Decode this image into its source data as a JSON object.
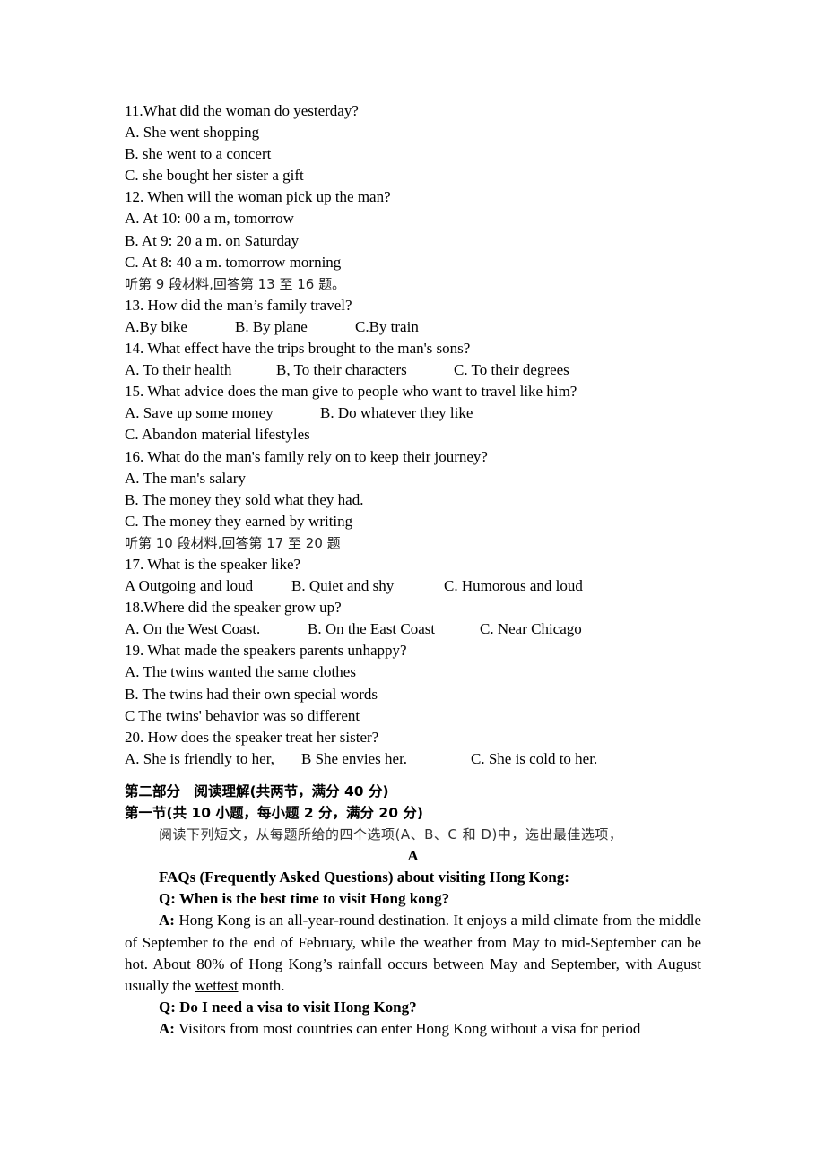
{
  "questions": [
    {
      "q": "11.What did the woman do yesterday?",
      "options": [
        "A. She went shopping",
        "B. she went to a concert",
        "C. she bought her sister a gift"
      ],
      "layout": "stacked"
    },
    {
      "q": "12. When will the woman pick up the man?",
      "options": [
        "A. At 10: 00 a m, tomorrow",
        "B. At 9: 20 a m. on Saturday",
        "C. At 8: 40 a m. tomorrow morning"
      ],
      "layout": "stacked"
    }
  ],
  "section9": "听第 9 段材料,回答第 13 至 16 题。",
  "q13": {
    "q": "13. How did the man’s family travel?",
    "options": [
      "A.By bike",
      "B. By plane",
      "C.By train"
    ]
  },
  "q14": {
    "q": "14. What effect have the trips brought to the man's sons?",
    "options": [
      "A. To their health",
      "B, To their characters",
      "C. To their degrees"
    ]
  },
  "q15": {
    "q": "15. What advice does the man give to people who want to travel like him?",
    "options": [
      "A. Save up some money",
      "B. Do whatever they like",
      "C. Abandon material lifestyles"
    ]
  },
  "q16": {
    "q": "16. What do the man's family rely on to keep their journey?",
    "options": [
      "A. The man's salary",
      "B. The money they sold what they had.",
      "C. The money they earned by writing"
    ]
  },
  "section10": "听第 10 段材料,回答第 17 至 20 题",
  "q17": {
    "q": "17. What is the speaker like?",
    "options": [
      "A Outgoing and loud",
      "B. Quiet and shy",
      "C. Humorous and loud"
    ]
  },
  "q18": {
    "q": "18.Where did the speaker grow up?",
    "options": [
      "A. On the West Coast.",
      "B. On the East Coast",
      "C. Near Chicago"
    ]
  },
  "q19": {
    "q": "19. What made the speakers parents unhappy?",
    "options": [
      "A. The twins wanted the same clothes",
      "B. The twins had their own special words",
      "C The twins' behavior was so different"
    ]
  },
  "q20": {
    "q": "20. How does the speaker treat her sister?",
    "options": [
      "A. She is friendly to her,",
      "B She envies her.",
      "C. She is cold to her."
    ]
  },
  "part2": {
    "title": "第二部分　阅读理解(共两节，满分 40 分)",
    "section1": "第一节(共 10 小题，每小题 2 分，满分 20 分)",
    "instruction": "阅读下列短文，从每题所给的四个选项(A、B、C 和 D)中，选出最佳选项，",
    "passage_label": "A",
    "faq_title": "FAQs (Frequently Asked Questions) about visiting Hong Kong:",
    "q1": "Q: When is the best time to visit Hong kong?",
    "a1_label": "A:",
    "a1_text_1": " Hong Kong is an all-year-round destination. It enjoys a mild climate from the middle of September to the end of February, while the weather from May to mid-September can be hot. About 80% of Hong Kong’s rainfall occurs between May and September, with August usually the ",
    "a1_underlined": "wettest",
    "a1_text_2": " month.",
    "q2": "Q: Do I need a visa to visit Hong Kong?",
    "a2_label": "A:",
    "a2_text": " Visitors from most countries can enter Hong Kong without a visa for period"
  }
}
